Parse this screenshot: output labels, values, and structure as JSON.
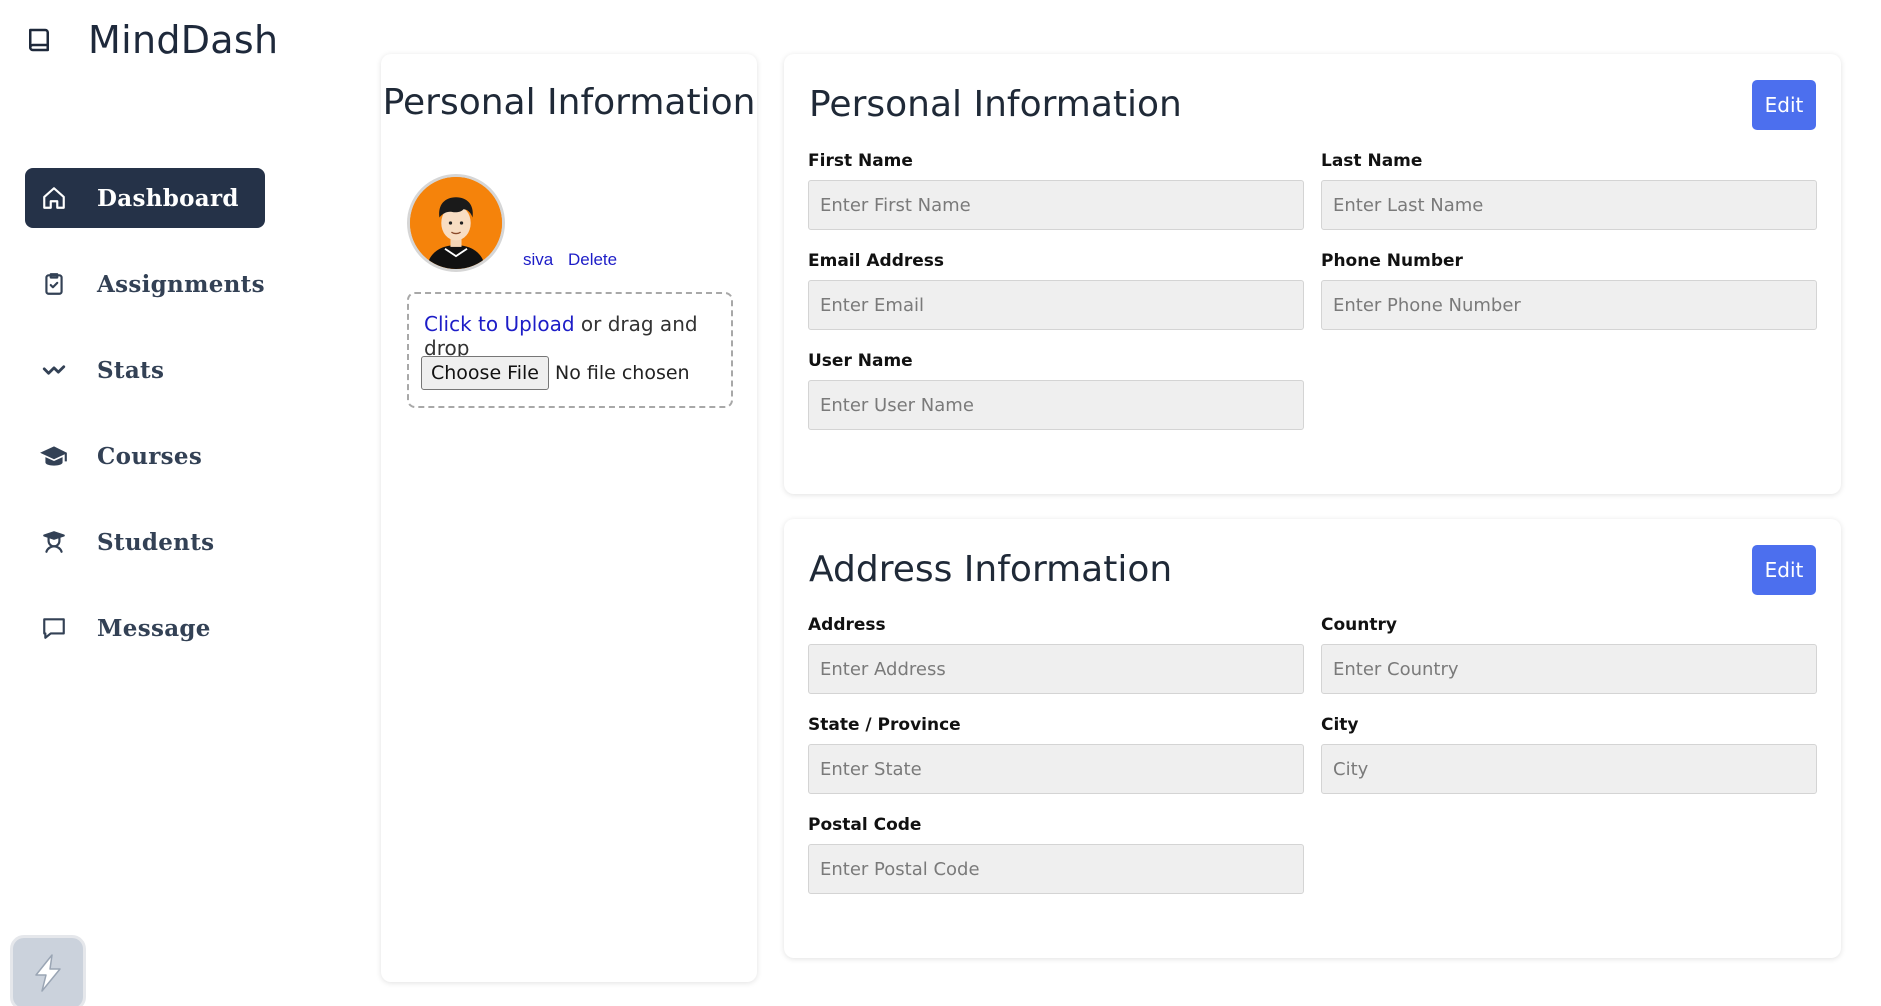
{
  "brand": {
    "title": "MindDash"
  },
  "nav": {
    "items": [
      {
        "label": "Dashboard",
        "icon": "home-icon",
        "active": true
      },
      {
        "label": "Assignments",
        "icon": "clipboard-check-icon"
      },
      {
        "label": "Stats",
        "icon": "trend-line-icon"
      },
      {
        "label": "Courses",
        "icon": "graduation-cap-icon"
      },
      {
        "label": "Students",
        "icon": "student-icon"
      },
      {
        "label": "Message",
        "icon": "chat-bubble-icon"
      }
    ]
  },
  "profile": {
    "title": "Personal Information",
    "username": "siva",
    "delete_label": "Delete",
    "upload_link": "Click to Upload",
    "upload_rest": "or drag and drop",
    "choose_file_label": "Choose File",
    "no_file_text": "No file chosen"
  },
  "personal": {
    "title": "Personal Information",
    "edit_label": "Edit",
    "first_name": {
      "label": "First Name",
      "placeholder": "Enter First Name"
    },
    "last_name": {
      "label": "Last Name",
      "placeholder": "Enter Last Name"
    },
    "email": {
      "label": "Email Address",
      "placeholder": "Enter Email"
    },
    "phone": {
      "label": "Phone Number",
      "placeholder": "Enter Phone Number"
    },
    "username": {
      "label": "User Name",
      "placeholder": "Enter User Name"
    }
  },
  "address": {
    "title": "Address Information",
    "edit_label": "Edit",
    "address": {
      "label": "Address",
      "placeholder": "Enter Address"
    },
    "country": {
      "label": "Country",
      "placeholder": "Enter Country"
    },
    "state": {
      "label": "State / Province",
      "placeholder": "Enter State"
    },
    "city": {
      "label": "City",
      "placeholder": "City"
    },
    "postal": {
      "label": "Postal Code",
      "placeholder": "Enter Postal Code"
    }
  },
  "colors": {
    "accent": "#4c6fee",
    "nav_active": "#253248",
    "avatar_bg": "#f5830b",
    "link": "#1d1dc7"
  }
}
